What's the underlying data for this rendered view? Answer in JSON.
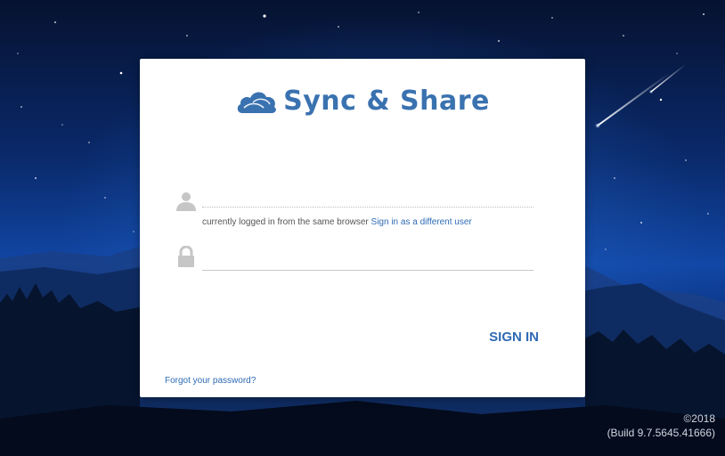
{
  "brand": {
    "name": "Sync & Share",
    "logo_icon": "cloud-icon",
    "color": "#3a72b0"
  },
  "login": {
    "username_icon": "user-icon",
    "username_value": "",
    "username_placeholder": "",
    "session_note": "currently logged in from the same browser",
    "switch_user_link": "Sign in as a different user",
    "password_icon": "lock-icon",
    "password_value": "",
    "password_placeholder": "",
    "signin_label": "SIGN IN",
    "forgot_password_link": "Forgot your password?",
    "accent_color": "#2f6bb5"
  },
  "footer": {
    "copyright": "©2018",
    "build": "(Build 9.7.5645.41666)"
  }
}
